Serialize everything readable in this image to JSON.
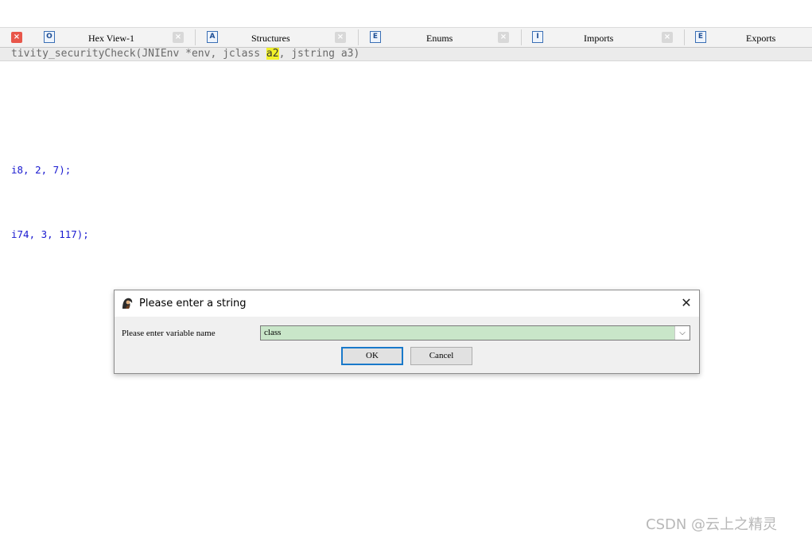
{
  "tabs": [
    {
      "label": "Hex View-1",
      "icon": "hex-view-icon",
      "icon_glyph": "O"
    },
    {
      "label": "Structures",
      "icon": "structures-icon",
      "icon_glyph": "A"
    },
    {
      "label": "Enums",
      "icon": "enums-icon",
      "icon_glyph": "E"
    },
    {
      "label": "Imports",
      "icon": "imports-icon",
      "icon_glyph": "I"
    },
    {
      "label": "Exports",
      "icon": "exports-icon",
      "icon_glyph": "E"
    }
  ],
  "close_glyph": "×",
  "code": {
    "signature_pre": "tivity_securityCheck(JNIEnv *env, jclass ",
    "signature_highlight": "a2",
    "signature_post": ", jstring a3)",
    "line1": "i8, 2, 7);",
    "line2": "i74, 3, 117);"
  },
  "dialog": {
    "title": "Please enter a string",
    "close_glyph": "✕",
    "field_label": "Please enter variable name",
    "field_value": "class",
    "dropdown_glyph": "⌵",
    "ok_label": "OK",
    "cancel_label": "Cancel"
  },
  "watermark": "CSDN @云上之精灵",
  "colors": {
    "active_close": "#e8564a",
    "highlight": "#f1f12a",
    "input_bg": "#c9e6c9",
    "ok_border": "#1979ca",
    "code_text": "#1a1ad0"
  }
}
